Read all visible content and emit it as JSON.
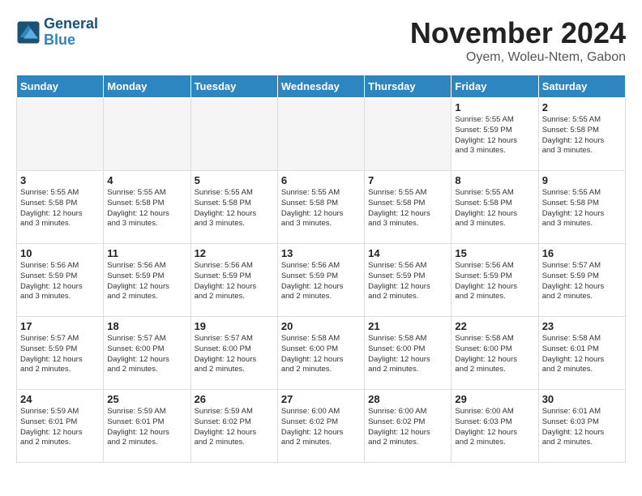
{
  "header": {
    "logo_line1": "General",
    "logo_line2": "Blue",
    "month": "November 2024",
    "location": "Oyem, Woleu-Ntem, Gabon"
  },
  "days_of_week": [
    "Sunday",
    "Monday",
    "Tuesday",
    "Wednesday",
    "Thursday",
    "Friday",
    "Saturday"
  ],
  "weeks": [
    [
      {
        "day": "",
        "info": ""
      },
      {
        "day": "",
        "info": ""
      },
      {
        "day": "",
        "info": ""
      },
      {
        "day": "",
        "info": ""
      },
      {
        "day": "",
        "info": ""
      },
      {
        "day": "1",
        "info": "Sunrise: 5:55 AM\nSunset: 5:59 PM\nDaylight: 12 hours\nand 3 minutes."
      },
      {
        "day": "2",
        "info": "Sunrise: 5:55 AM\nSunset: 5:58 PM\nDaylight: 12 hours\nand 3 minutes."
      }
    ],
    [
      {
        "day": "3",
        "info": "Sunrise: 5:55 AM\nSunset: 5:58 PM\nDaylight: 12 hours\nand 3 minutes."
      },
      {
        "day": "4",
        "info": "Sunrise: 5:55 AM\nSunset: 5:58 PM\nDaylight: 12 hours\nand 3 minutes."
      },
      {
        "day": "5",
        "info": "Sunrise: 5:55 AM\nSunset: 5:58 PM\nDaylight: 12 hours\nand 3 minutes."
      },
      {
        "day": "6",
        "info": "Sunrise: 5:55 AM\nSunset: 5:58 PM\nDaylight: 12 hours\nand 3 minutes."
      },
      {
        "day": "7",
        "info": "Sunrise: 5:55 AM\nSunset: 5:58 PM\nDaylight: 12 hours\nand 3 minutes."
      },
      {
        "day": "8",
        "info": "Sunrise: 5:55 AM\nSunset: 5:58 PM\nDaylight: 12 hours\nand 3 minutes."
      },
      {
        "day": "9",
        "info": "Sunrise: 5:55 AM\nSunset: 5:58 PM\nDaylight: 12 hours\nand 3 minutes."
      }
    ],
    [
      {
        "day": "10",
        "info": "Sunrise: 5:56 AM\nSunset: 5:59 PM\nDaylight: 12 hours\nand 3 minutes."
      },
      {
        "day": "11",
        "info": "Sunrise: 5:56 AM\nSunset: 5:59 PM\nDaylight: 12 hours\nand 2 minutes."
      },
      {
        "day": "12",
        "info": "Sunrise: 5:56 AM\nSunset: 5:59 PM\nDaylight: 12 hours\nand 2 minutes."
      },
      {
        "day": "13",
        "info": "Sunrise: 5:56 AM\nSunset: 5:59 PM\nDaylight: 12 hours\nand 2 minutes."
      },
      {
        "day": "14",
        "info": "Sunrise: 5:56 AM\nSunset: 5:59 PM\nDaylight: 12 hours\nand 2 minutes."
      },
      {
        "day": "15",
        "info": "Sunrise: 5:56 AM\nSunset: 5:59 PM\nDaylight: 12 hours\nand 2 minutes."
      },
      {
        "day": "16",
        "info": "Sunrise: 5:57 AM\nSunset: 5:59 PM\nDaylight: 12 hours\nand 2 minutes."
      }
    ],
    [
      {
        "day": "17",
        "info": "Sunrise: 5:57 AM\nSunset: 5:59 PM\nDaylight: 12 hours\nand 2 minutes."
      },
      {
        "day": "18",
        "info": "Sunrise: 5:57 AM\nSunset: 6:00 PM\nDaylight: 12 hours\nand 2 minutes."
      },
      {
        "day": "19",
        "info": "Sunrise: 5:57 AM\nSunset: 6:00 PM\nDaylight: 12 hours\nand 2 minutes."
      },
      {
        "day": "20",
        "info": "Sunrise: 5:58 AM\nSunset: 6:00 PM\nDaylight: 12 hours\nand 2 minutes."
      },
      {
        "day": "21",
        "info": "Sunrise: 5:58 AM\nSunset: 6:00 PM\nDaylight: 12 hours\nand 2 minutes."
      },
      {
        "day": "22",
        "info": "Sunrise: 5:58 AM\nSunset: 6:00 PM\nDaylight: 12 hours\nand 2 minutes."
      },
      {
        "day": "23",
        "info": "Sunrise: 5:58 AM\nSunset: 6:01 PM\nDaylight: 12 hours\nand 2 minutes."
      }
    ],
    [
      {
        "day": "24",
        "info": "Sunrise: 5:59 AM\nSunset: 6:01 PM\nDaylight: 12 hours\nand 2 minutes."
      },
      {
        "day": "25",
        "info": "Sunrise: 5:59 AM\nSunset: 6:01 PM\nDaylight: 12 hours\nand 2 minutes."
      },
      {
        "day": "26",
        "info": "Sunrise: 5:59 AM\nSunset: 6:02 PM\nDaylight: 12 hours\nand 2 minutes."
      },
      {
        "day": "27",
        "info": "Sunrise: 6:00 AM\nSunset: 6:02 PM\nDaylight: 12 hours\nand 2 minutes."
      },
      {
        "day": "28",
        "info": "Sunrise: 6:00 AM\nSunset: 6:02 PM\nDaylight: 12 hours\nand 2 minutes."
      },
      {
        "day": "29",
        "info": "Sunrise: 6:00 AM\nSunset: 6:03 PM\nDaylight: 12 hours\nand 2 minutes."
      },
      {
        "day": "30",
        "info": "Sunrise: 6:01 AM\nSunset: 6:03 PM\nDaylight: 12 hours\nand 2 minutes."
      }
    ]
  ]
}
